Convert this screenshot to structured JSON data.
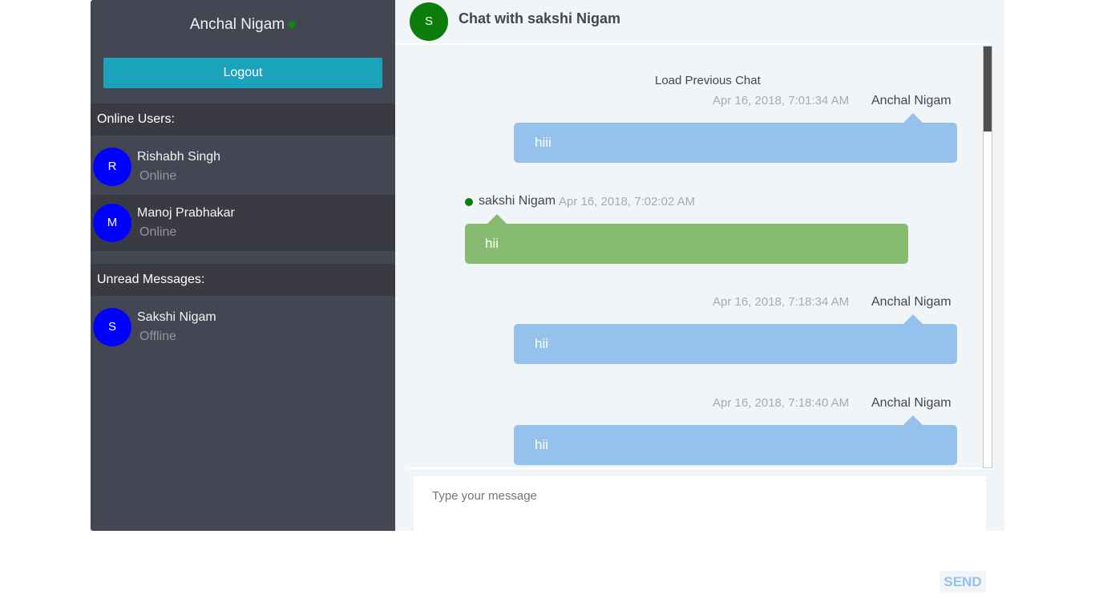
{
  "sidebar": {
    "current_user": "Anchal Nigam",
    "logout_label": "Logout",
    "online_heading": "Online Users:",
    "online_users": [
      {
        "initial": "R",
        "name": "Rishabh Singh",
        "status": "Online"
      },
      {
        "initial": "M",
        "name": "Manoj Prabhakar",
        "status": "Online"
      }
    ],
    "unread_heading": "Unread Messages:",
    "unread_users": [
      {
        "initial": "S",
        "name": "Sakshi Nigam",
        "status": "Offline"
      }
    ]
  },
  "chat": {
    "avatar_initial": "S",
    "title": "Chat with sakshi Nigam",
    "load_previous": "Load Previous Chat",
    "messages": [
      {
        "sender": "Anchal Nigam",
        "time": "Apr 16, 2018, 7:01:34 AM",
        "text": "hiii"
      },
      {
        "sender": "sakshi Nigam",
        "time": "Apr 16, 2018, 7:02:02 AM",
        "text": "hii"
      },
      {
        "sender": "Anchal Nigam",
        "time": "Apr 16, 2018, 7:18:34 AM",
        "text": "hii"
      },
      {
        "sender": "Anchal Nigam",
        "time": "Apr 16, 2018, 7:18:40 AM",
        "text": "hii"
      }
    ],
    "input_placeholder": "Type your message",
    "send_label": "SEND"
  },
  "colors": {
    "sidebar_bg": "#444753",
    "accent": "#1aa3ba",
    "outgoing_bubble": "#94c2ed",
    "incoming_bubble": "#86bb71",
    "online_dot": "#0a7d0a",
    "avatar": "#0000ff"
  }
}
